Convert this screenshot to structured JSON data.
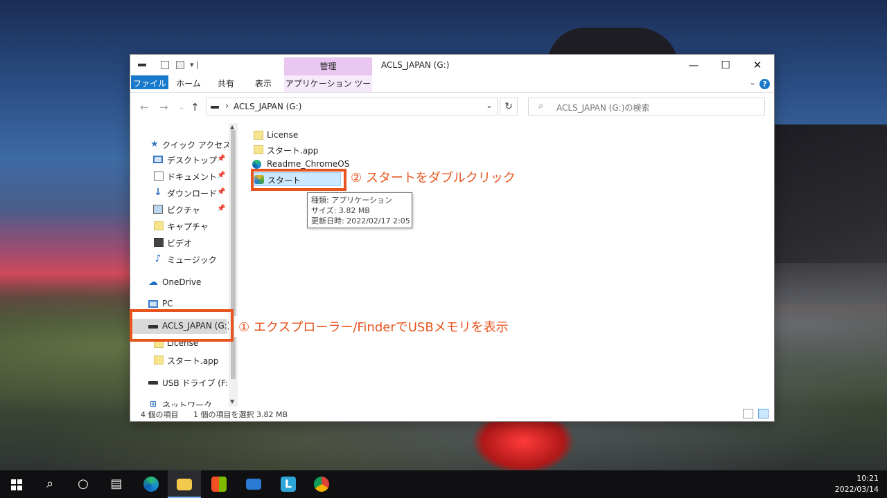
{
  "window": {
    "title": "ACLS_JAPAN (G:)",
    "context_tab_header": "管理",
    "controls": {
      "minimize": "—",
      "maximize": "☐",
      "close": "✕"
    }
  },
  "ribbon": {
    "tabs": [
      "ファイル",
      "ホーム",
      "共有",
      "表示",
      "アプリケーション ツール"
    ],
    "help": "?"
  },
  "address": {
    "path": "ACLS_JAPAN (G:)",
    "search_placeholder": "ACLS_JAPAN (G:)の検索"
  },
  "nav_pane": {
    "items": [
      {
        "label": "クイック アクセス",
        "icon": "star-icon"
      },
      {
        "label": "デスクトップ",
        "icon": "desktop-icon",
        "pinned": true
      },
      {
        "label": "ドキュメント",
        "icon": "document-icon",
        "pinned": true
      },
      {
        "label": "ダウンロード",
        "icon": "download-icon",
        "pinned": true
      },
      {
        "label": "ピクチャ",
        "icon": "picture-icon",
        "pinned": true
      },
      {
        "label": "キャプチャ",
        "icon": "folder-icon"
      },
      {
        "label": "ビデオ",
        "icon": "video-icon"
      },
      {
        "label": "ミュージック",
        "icon": "music-icon"
      },
      {
        "label": "OneDrive",
        "icon": "onedrive-icon"
      },
      {
        "label": "PC",
        "icon": "pc-icon"
      },
      {
        "label": "ACLS_JAPAN (G:)",
        "icon": "drive-icon",
        "selected": true
      },
      {
        "label": "License",
        "icon": "folder-icon"
      },
      {
        "label": "スタート.app",
        "icon": "folder-icon"
      },
      {
        "label": "USB ドライブ (F:)",
        "icon": "drive-icon"
      },
      {
        "label": "ネットワーク",
        "icon": "network-icon"
      }
    ]
  },
  "files": [
    {
      "name": "License",
      "icon": "folder-icon"
    },
    {
      "name": "スタート.app",
      "icon": "folder-icon"
    },
    {
      "name": "Readme_ChromeOS",
      "icon": "edge-icon"
    },
    {
      "name": "スタート",
      "icon": "app-icon",
      "selected": true
    }
  ],
  "tooltip": {
    "type": "種類: アプリケーション",
    "size": "サイズ: 3.82 MB",
    "modified": "更新日時: 2022/02/17 2:05"
  },
  "status": {
    "count": "4 個の項目",
    "selection": "1 個の項目を選択  3.82 MB"
  },
  "annotations": {
    "step1": "① エクスプローラー/FinderでUSBメモリを表示",
    "step2": "② スタートをダブルクリック",
    "color": "#e8541e"
  },
  "taskbar": {
    "clock_time": "10:21",
    "clock_date": "2022/03/14"
  }
}
